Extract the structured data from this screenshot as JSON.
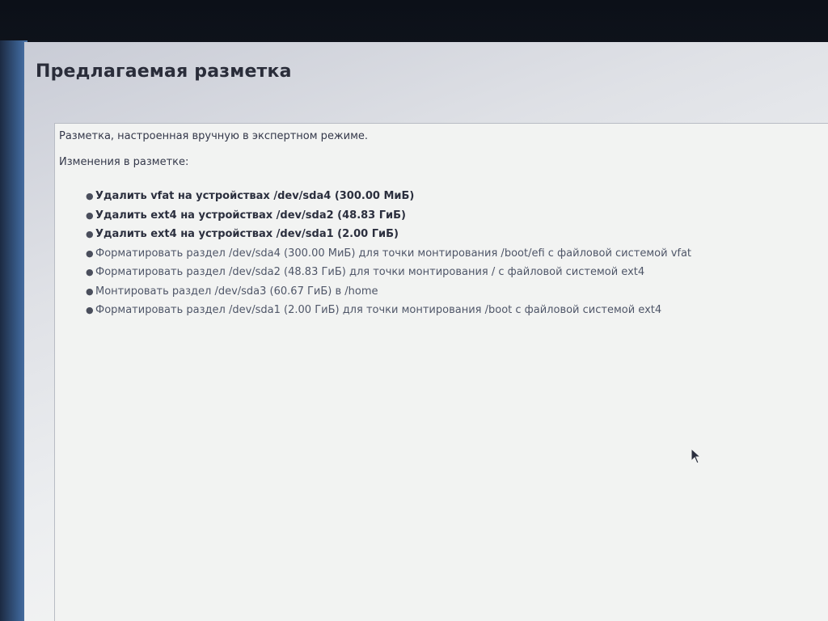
{
  "window": {
    "title": "Предлагаемая разметка"
  },
  "panel": {
    "summary": "Разметка, настроенная вручную в экспертном режиме.",
    "changes_heading": "Изменения в разметке:",
    "changes": [
      {
        "text": "Удалить vfat на устройствах /dev/sda4 (300.00 МиБ)",
        "emphasis": "bold"
      },
      {
        "text": "Удалить ext4 на устройствах /dev/sda2 (48.83 ГиБ)",
        "emphasis": "bold"
      },
      {
        "text": "Удалить ext4 на устройствах /dev/sda1 (2.00 ГиБ)",
        "emphasis": "bold"
      },
      {
        "text": "Форматировать раздел /dev/sda4 (300.00 МиБ) для точки монтирования /boot/efi с файловой системой vfat",
        "emphasis": "normal"
      },
      {
        "text": "Форматировать раздел /dev/sda2 (48.83 ГиБ) для точки монтирования / с файловой системой ext4",
        "emphasis": "normal"
      },
      {
        "text": "Монтировать раздел /dev/sda3 (60.67 ГиБ) в /home",
        "emphasis": "normal"
      },
      {
        "text": "Форматировать раздел /dev/sda1 (2.00 ГиБ) для точки монтирования /boot с файловой системой ext4",
        "emphasis": "normal"
      }
    ]
  },
  "icons": {
    "bullet": "bullet-icon",
    "cursor": "mouse-pointer-icon"
  },
  "colors": {
    "title": "#2a2d3a",
    "destructive_text": "#2b2f3e",
    "normal_text": "#4f5668",
    "panel_background": "#f2f3f2"
  }
}
